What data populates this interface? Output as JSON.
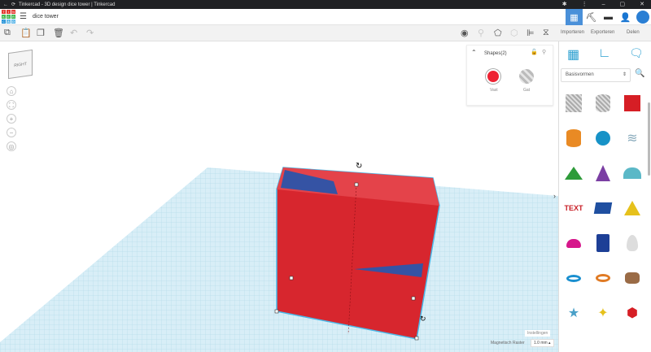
{
  "browser": {
    "title": "Tinkercad - 3D design dice tower | Tinkercad"
  },
  "header": {
    "design_name": "dice tower",
    "logo_letters": [
      "TIN",
      "KER",
      "CAD"
    ]
  },
  "toolbar": {
    "import": "Importeren",
    "export": "Exporteren",
    "share": "Delen"
  },
  "view_cube": {
    "face": "RIGHT"
  },
  "shapes_panel": {
    "title": "Shapes(2)",
    "solid_label": "Vast",
    "hole_label": "Gat",
    "solid_color": "#ee2233"
  },
  "sidebar": {
    "category": "Basisvormen"
  },
  "footer": {
    "settings": "Instellingen",
    "snap_label": "Magnetisch Raster",
    "snap_value": "1.0 mm"
  },
  "colors": {
    "accent": "#4a90d9",
    "box": "#d7262e",
    "grid": "#c9e6f2"
  }
}
